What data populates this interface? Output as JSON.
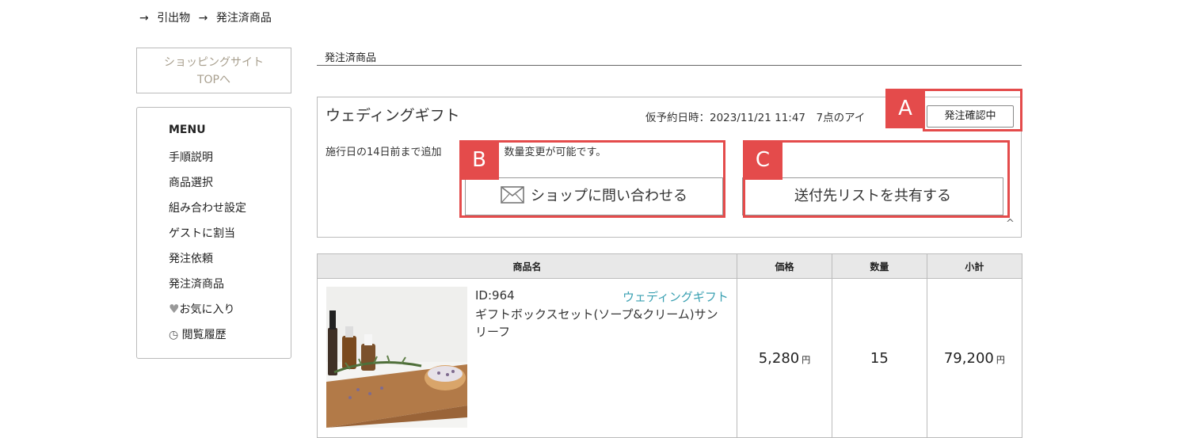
{
  "breadcrumb": {
    "arrow1": "→",
    "item1": "引出物",
    "arrow2": "→",
    "item2": "発注済商品"
  },
  "sidebar": {
    "top_button": {
      "line1": "ショッピングサイト",
      "line2": "TOPへ"
    },
    "menu_title": "MENU",
    "items": [
      {
        "label": "手順説明"
      },
      {
        "label": "商品選択"
      },
      {
        "label": "組み合わせ設定"
      },
      {
        "label": "ゲストに割当"
      },
      {
        "label": "発注依頼"
      },
      {
        "label": "発注済商品"
      },
      {
        "label": "お気に入り",
        "icon": "heart-icon"
      },
      {
        "label": "閲覧履歴",
        "icon": "clock-icon"
      }
    ]
  },
  "main": {
    "section_title": "発注済商品",
    "order": {
      "title": "ウェディングギフト",
      "meta": "仮予約日時：2023/11/21 11:47　7点のアイ",
      "status": "発注確認中",
      "note": "施行日の14日前まで追加",
      "note_tail": "、数量変更が可能です。",
      "contact_label": "ショップに問い合わせる",
      "share_label": "送付先リストを共有する",
      "collapse": "^"
    },
    "annotations": {
      "a": "A",
      "b": "B",
      "c": "C"
    },
    "table": {
      "headers": {
        "name": "商品名",
        "price": "価格",
        "qty": "数量",
        "subtotal": "小計"
      },
      "rows": [
        {
          "id": "ID:964",
          "category": "ウェディングギフト",
          "name": "ギフトボックスセット(ソープ&クリーム)サンリーフ",
          "price": "5,280",
          "qty": "15",
          "subtotal": "79,200",
          "unit": "円"
        }
      ]
    }
  },
  "colors": {
    "highlight": "#e44b4b",
    "link": "#3aa0b2"
  }
}
